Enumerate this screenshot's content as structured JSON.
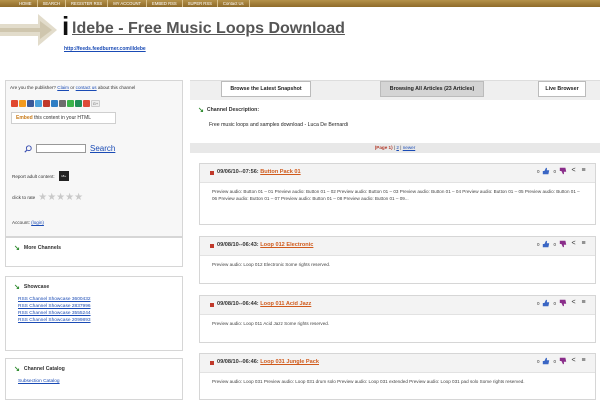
{
  "nav": [
    "HOME",
    "SEARCH",
    "REGISTER RSS",
    "MY ACCOUNT",
    "EMBED RSS",
    "SUPER RSS",
    "Contact Us"
  ],
  "header": {
    "title_initial": "i",
    "title_rest": "ldebe - Free Music Loops Download",
    "feed_url": "http://feeds.feedburner.com/ildebe"
  },
  "publisher": {
    "question_prefix": "Are you the publisher?",
    "claim_link": "Claim",
    "or": "or",
    "contact_link": "contact us",
    "question_suffix": "about this channel",
    "embed_prefix": "Embed",
    "embed_suffix": "this content in your HTML",
    "search_label": "Search",
    "adult_label": "Report adult content:",
    "adult_badge": "18+",
    "rate_label": "click to rate",
    "account_prefix": "Account:",
    "account_link": "(login)",
    "share_colors": [
      "#e0472f",
      "#f29a1e",
      "#3b5998",
      "#4aa0d9",
      "#c0392b",
      "#2f7ec4",
      "#6d6d6d",
      "#3bb34a",
      "#1f8f58",
      "#dd4b39"
    ]
  },
  "left": {
    "more_channels": "More Channels",
    "showcase_title": "Showcase",
    "showcase_links": [
      "RSS Channel Showcase 3600432",
      "RSS Channel Showcase 2837996",
      "RSS Channel Showcase 3555244",
      "RSS Channel Showcase 2099893"
    ],
    "catalog_title": "Channel Catalog",
    "catalog_links": [
      "Subsection Catalog"
    ]
  },
  "tabs": {
    "snapshot": "Browse the Latest Snapshot",
    "all_articles": "Browsing All Articles (23 Articles)",
    "live": "Live Browser"
  },
  "channel": {
    "desc_label": "Channel Description:",
    "desc_text": "Free music loops and samples download - Luca De Bernardi"
  },
  "pager": {
    "current": "(Page 1)",
    "sep1": "|",
    "page2": "2",
    "sep2": "|",
    "newer": "newer"
  },
  "items": [
    {
      "stamp": "09/06/10--07:56:",
      "title": "Button Pack 01",
      "votes_up": "0",
      "votes_down": "0",
      "body": "Preview audio: Button 01 – 01 Preview audio: Button 01 – 02 Preview audio: Button 01 – 03 Preview audio: Button 01 – 04 Preview audio: Button 01 – 05 Preview audio: Button 01 – 06 Preview audio: Button 01 – 07 Preview audio: Button 01 – 08 Preview audio: Button 01 – 09..."
    },
    {
      "stamp": "09/08/10--06:43:",
      "title": "Loop 012 Electronic",
      "votes_up": "0",
      "votes_down": "0",
      "body": "Preview audio: Loop 012 Electronic Some rights reserved."
    },
    {
      "stamp": "09/08/10--06:44:",
      "title": "Loop 011 Acid Jazz",
      "votes_up": "0",
      "votes_down": "0",
      "body": "Preview audio: Loop 011 Acid Jazz Some rights reserved."
    },
    {
      "stamp": "09/08/10--06:46:",
      "title": "Loop 031 Jungle Pack",
      "votes_up": "0",
      "votes_down": "0",
      "body": "Preview audio: Loop 031 Preview audio: Loop 031 drum solo Preview audio: Loop 031 extended Preview audio: Loop 031 pad solo Some rights reserved."
    }
  ]
}
